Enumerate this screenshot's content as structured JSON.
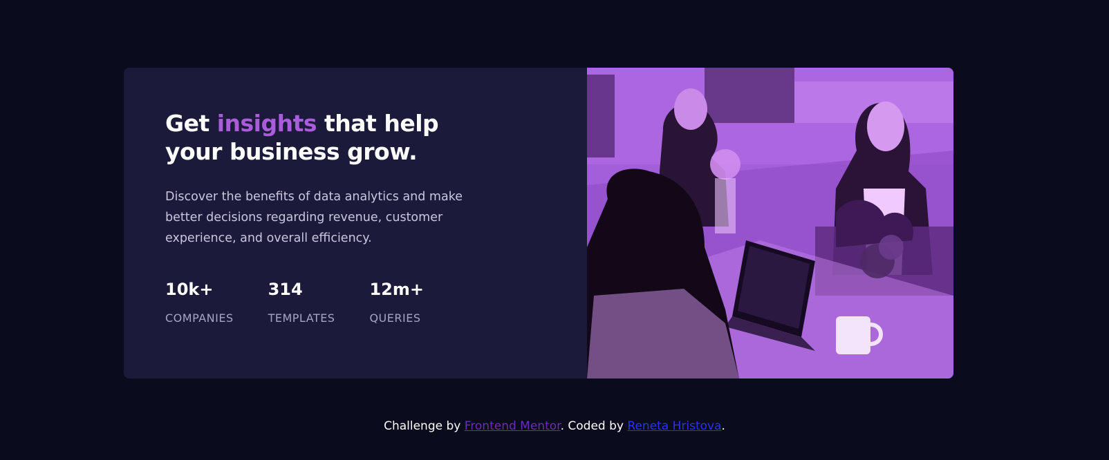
{
  "theme": {
    "background": "#0a0c1d",
    "card_background": "#1b1a3a",
    "accent": "#aa5cdb",
    "image_tint": "#a25fd9"
  },
  "hero": {
    "title_before": "Get ",
    "title_accent": "insights",
    "title_after": " that help your business grow.",
    "description": "Discover the benefits of data analytics and make better decisions regarding revenue, customer experience, and overall efficiency."
  },
  "stats": [
    {
      "value": "10k+",
      "label": "COMPANIES"
    },
    {
      "value": "314",
      "label": "TEMPLATES"
    },
    {
      "value": "12m+",
      "label": "QUERIES"
    }
  ],
  "image": {
    "icon": "office-meeting-photo"
  },
  "footer": {
    "prefix": "Challenge by ",
    "challenge_link": "Frontend Mentor",
    "middle": ". Coded by ",
    "author_link": "Reneta Hristova",
    "suffix": "."
  }
}
